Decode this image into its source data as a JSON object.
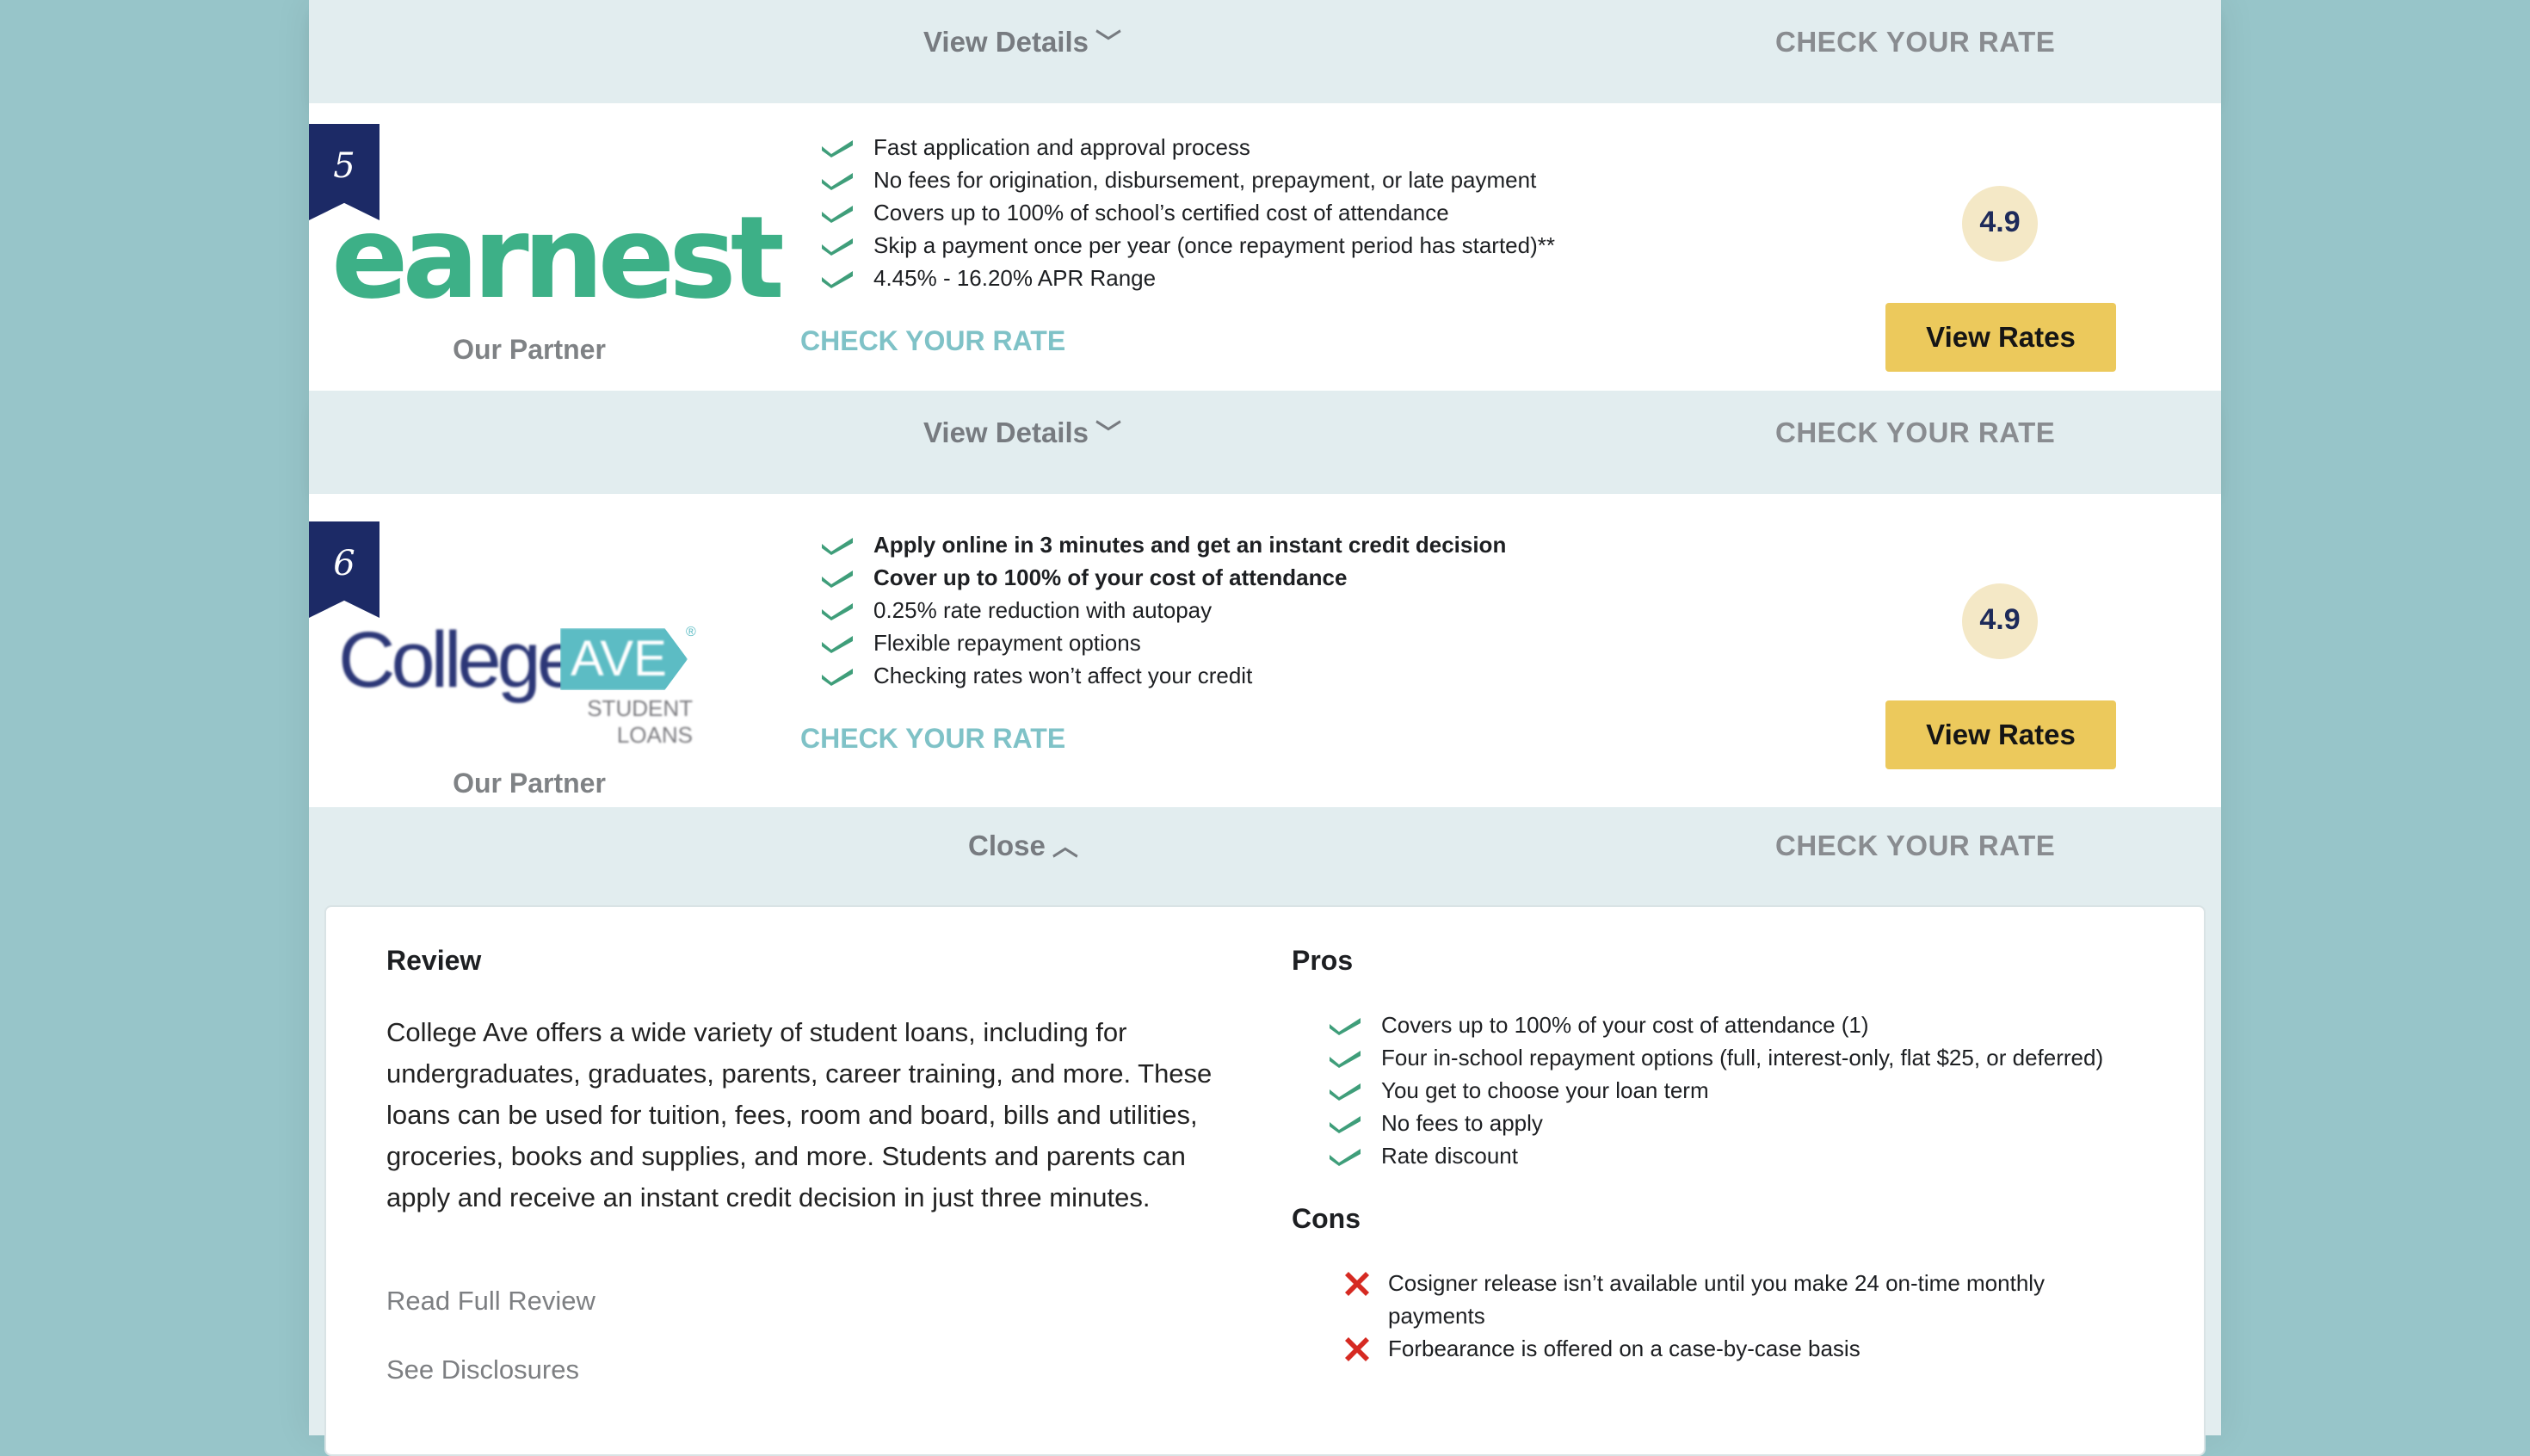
{
  "top_bar": {
    "view_details": "View Details",
    "check_rate": "CHECK YOUR RATE"
  },
  "cards": [
    {
      "rank": "5",
      "logo_text": "earnest",
      "partner_label": "Our Partner",
      "features": [
        "Fast application and approval process",
        "No fees for origination, disbursement, prepayment, or late payment",
        "Covers up to 100% of school’s certified cost of attendance",
        "Skip a payment once per year (once repayment period has started)**",
        "4.45% - 16.20% APR Range"
      ],
      "check_rate_link": "CHECK YOUR RATE",
      "rating": "4.9",
      "view_rates": "View Rates",
      "bar": {
        "view_details": "View Details",
        "check_rate": "CHECK YOUR RATE"
      }
    },
    {
      "rank": "6",
      "logo_text": {
        "college": "College",
        "ave": "AVE",
        "sub": "STUDENT LOANS"
      },
      "partner_label": "Our Partner",
      "features": [
        "Apply online in 3 minutes and get an instant credit decision",
        "Cover up to 100% of your cost of attendance",
        "0.25% rate reduction with autopay",
        "Flexible repayment options",
        "Checking rates won’t affect your credit"
      ],
      "check_rate_link": "CHECK YOUR RATE",
      "rating": "4.9",
      "view_rates": "View Rates",
      "bar": {
        "close": "Close",
        "check_rate": "CHECK YOUR RATE"
      },
      "details": {
        "review_heading": "Review",
        "review_text": "College Ave offers a wide variety of student loans, including for undergraduates, graduates, parents, career training, and more. These loans can be used for tuition, fees, room and board, bills and utilities, groceries, books and supplies, and more. Students and parents can apply and receive an instant credit decision in just three minutes.",
        "read_full_review": "Read Full Review",
        "see_disclosures": "See Disclosures",
        "pros_heading": "Pros",
        "pros": [
          "Covers up to 100% of your cost of attendance (1)",
          "Four in-school repayment options (full, interest-only, flat $25, or deferred)",
          "You get to choose your loan term",
          "No fees to apply",
          "Rate discount"
        ],
        "cons_heading": "Cons",
        "cons": [
          "Cosigner release isn’t available until you make 24 on-time monthly payments",
          "Forbearance is offered on a case-by-case basis"
        ]
      }
    }
  ],
  "colors": {
    "background": "#97c5c9",
    "ribbon": "#1c2a66",
    "earnest_green": "#3db087",
    "check_green": "#3f9e7a",
    "link_teal": "#7fc2c7",
    "button_yellow": "#ecc95c",
    "rating_bg": "#f4e8c6",
    "con_red": "#d62a22"
  },
  "icons": {
    "feature_bullet": "checkmark-icon",
    "con_bullet": "x-mark-icon",
    "expand": "chevron-down-icon",
    "collapse": "chevron-up-icon"
  }
}
